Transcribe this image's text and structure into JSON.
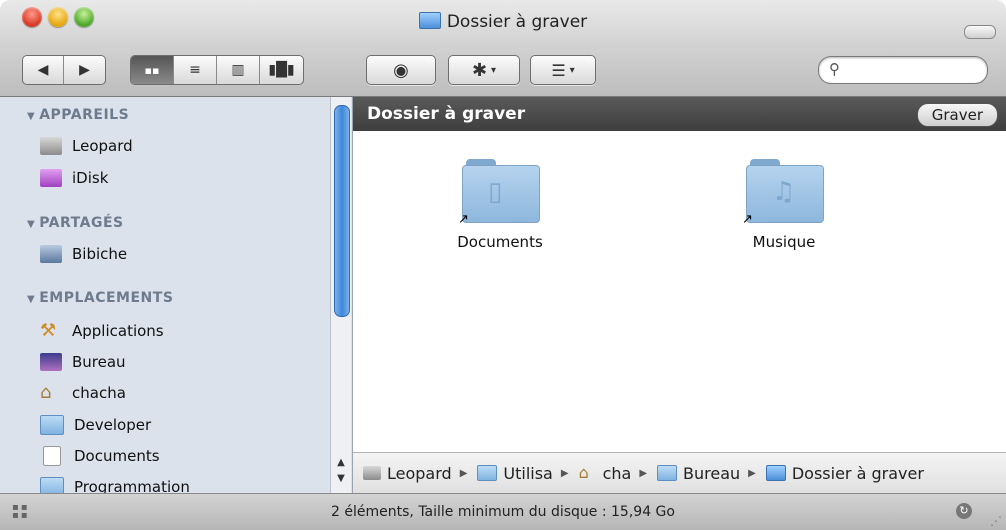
{
  "window": {
    "title": "Dossier à graver"
  },
  "toolbar": {
    "back_icon": "back-arrow-icon",
    "forward_icon": "forward-arrow-icon",
    "view_icons": [
      "icon-view-icon",
      "list-view-icon",
      "column-view-icon",
      "coverflow-view-icon"
    ],
    "quicklook_icon": "eye-icon",
    "action_icon": "gear-icon",
    "arrange_icon": "arrange-icon",
    "search_placeholder": ""
  },
  "sidebar": {
    "sections": [
      {
        "title": "APPAREILS",
        "items": [
          {
            "label": "Leopard",
            "icon": "hard-disk-icon",
            "color": "#9a9a9a"
          },
          {
            "label": "iDisk",
            "icon": "idisk-icon",
            "color": "#b25ac8"
          }
        ]
      },
      {
        "title": "PARTAGÉS",
        "items": [
          {
            "label": "Bibiche",
            "icon": "computer-icon",
            "color": "#6c88a8"
          }
        ]
      },
      {
        "title": "EMPLACEMENTS",
        "items": [
          {
            "label": "Applications",
            "icon": "applications-icon",
            "color": "#d7a23c"
          },
          {
            "label": "Bureau",
            "icon": "desktop-icon",
            "color": "#6a5aa8"
          },
          {
            "label": "chacha",
            "icon": "home-icon",
            "color": "#c29a55"
          },
          {
            "label": "Developer",
            "icon": "folder-icon",
            "color": "#7fb2e0"
          },
          {
            "label": "Documents",
            "icon": "documents-icon",
            "color": "#e8e8e8"
          },
          {
            "label": "Programmation",
            "icon": "folder-icon",
            "color": "#7fb2e0"
          }
        ]
      }
    ]
  },
  "main": {
    "header_title": "Dossier à graver",
    "burn_label": "Graver",
    "files": [
      {
        "label": "Documents",
        "emblem": "document-emblem-icon"
      },
      {
        "label": "Musique",
        "emblem": "music-note-emblem-icon"
      }
    ]
  },
  "pathbar": {
    "items": [
      {
        "label": "Leopard",
        "icon": "hard-disk-icon",
        "color": "#9a9a9a"
      },
      {
        "label": "Utilisa",
        "icon": "folder-icon",
        "color": "#7fb2e0"
      },
      {
        "label": "cha",
        "icon": "home-icon",
        "color": "#c29a55"
      },
      {
        "label": "Bureau",
        "icon": "folder-icon",
        "color": "#7fb2e0"
      },
      {
        "label": "Dossier à graver",
        "icon": "burn-folder-icon",
        "color": "#7fb2e0"
      }
    ]
  },
  "status": {
    "text": "2 éléments, Taille minimum du disque : 15,94 Go"
  }
}
